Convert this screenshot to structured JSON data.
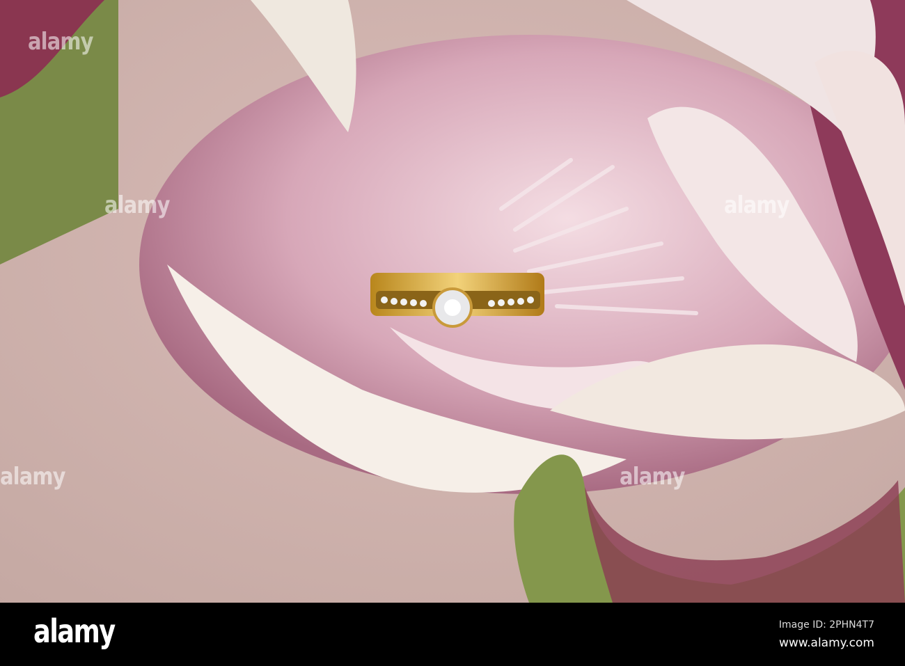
{
  "watermark": "alamy",
  "footer": {
    "logo": "alamy",
    "image_id": "Image ID: 2PHN4T7",
    "url": "www.alamy.com"
  }
}
